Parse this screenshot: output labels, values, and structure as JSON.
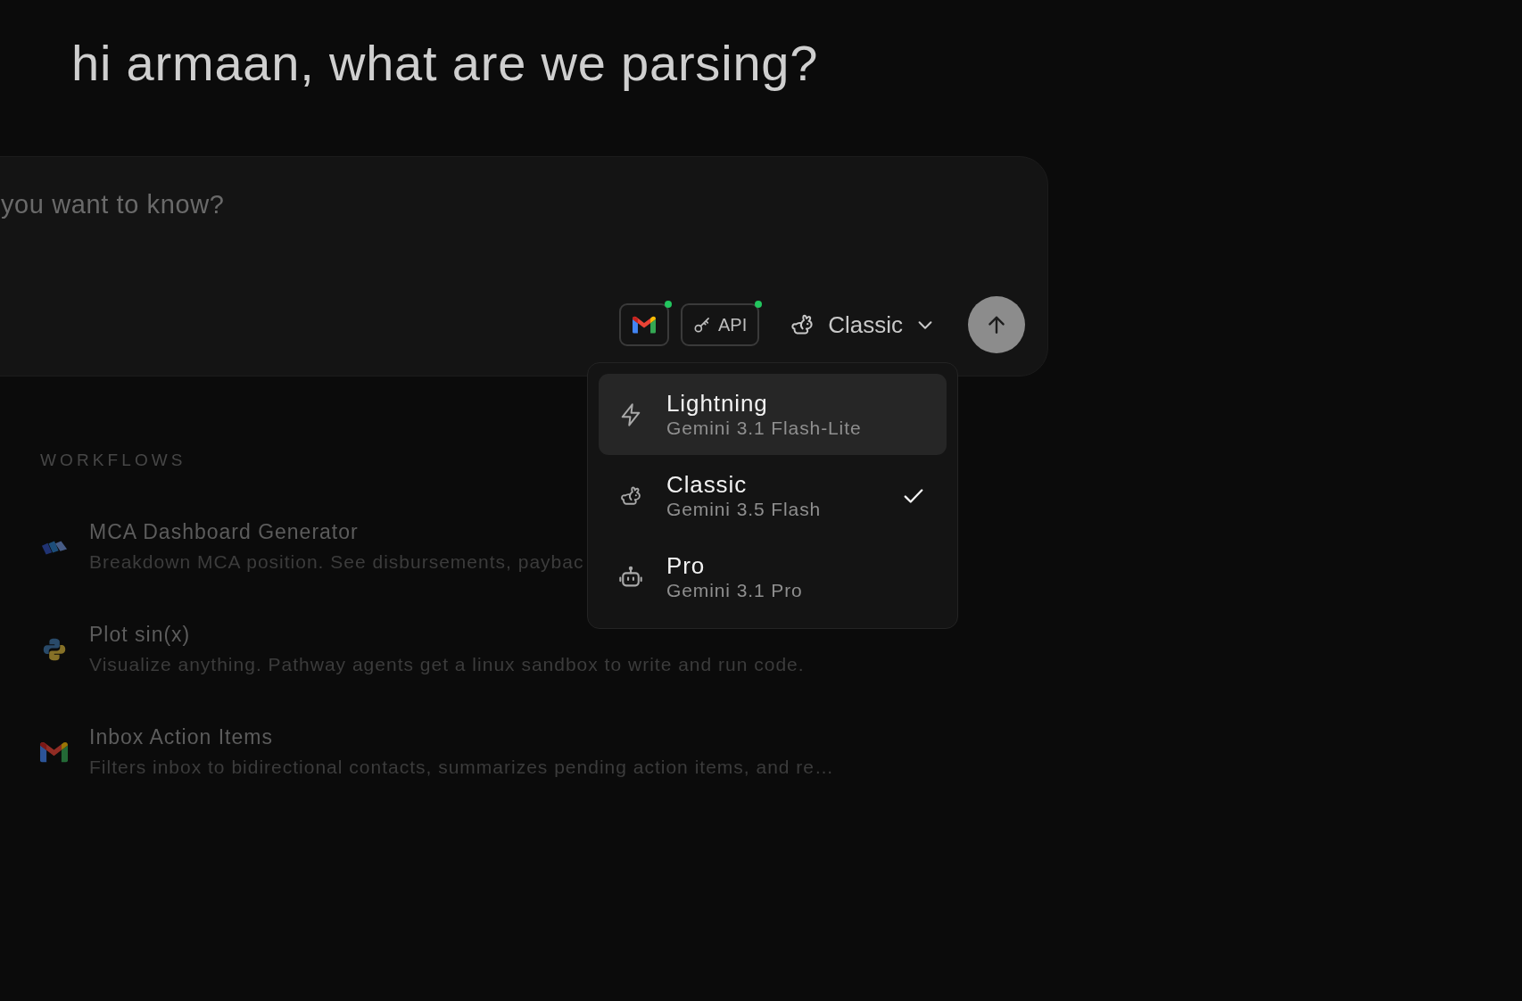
{
  "greeting": "hi armaan, what are we parsing?",
  "composer": {
    "placeholder": "you want to know?",
    "tools": [
      {
        "kind": "icon",
        "connected": true
      },
      {
        "kind": "labeled",
        "label": "API",
        "connected": true
      }
    ],
    "model_picker": {
      "label": "Classic",
      "expanded": true,
      "options": [
        {
          "name": "Lightning",
          "model": "Gemini 3.1 Flash-Lite",
          "highlighted": true,
          "selected": false
        },
        {
          "name": "Classic",
          "model": "Gemini 3.5 Flash",
          "highlighted": false,
          "selected": true
        },
        {
          "name": "Pro",
          "model": "Gemini 3.1 Pro",
          "highlighted": false,
          "selected": false
        }
      ]
    }
  },
  "workflows": {
    "heading": "WORKFLOWS",
    "items": [
      {
        "title": "MCA Dashboard Generator",
        "description": "Breakdown MCA position. See disbursements, paybac"
      },
      {
        "title": "Plot sin(x)",
        "description": "Visualize anything. Pathway agents get a linux sandbox to write and run code."
      },
      {
        "title": "Inbox Action Items",
        "description": "Filters inbox to bidirectional contacts, summarizes pending action items, and re…"
      }
    ]
  }
}
